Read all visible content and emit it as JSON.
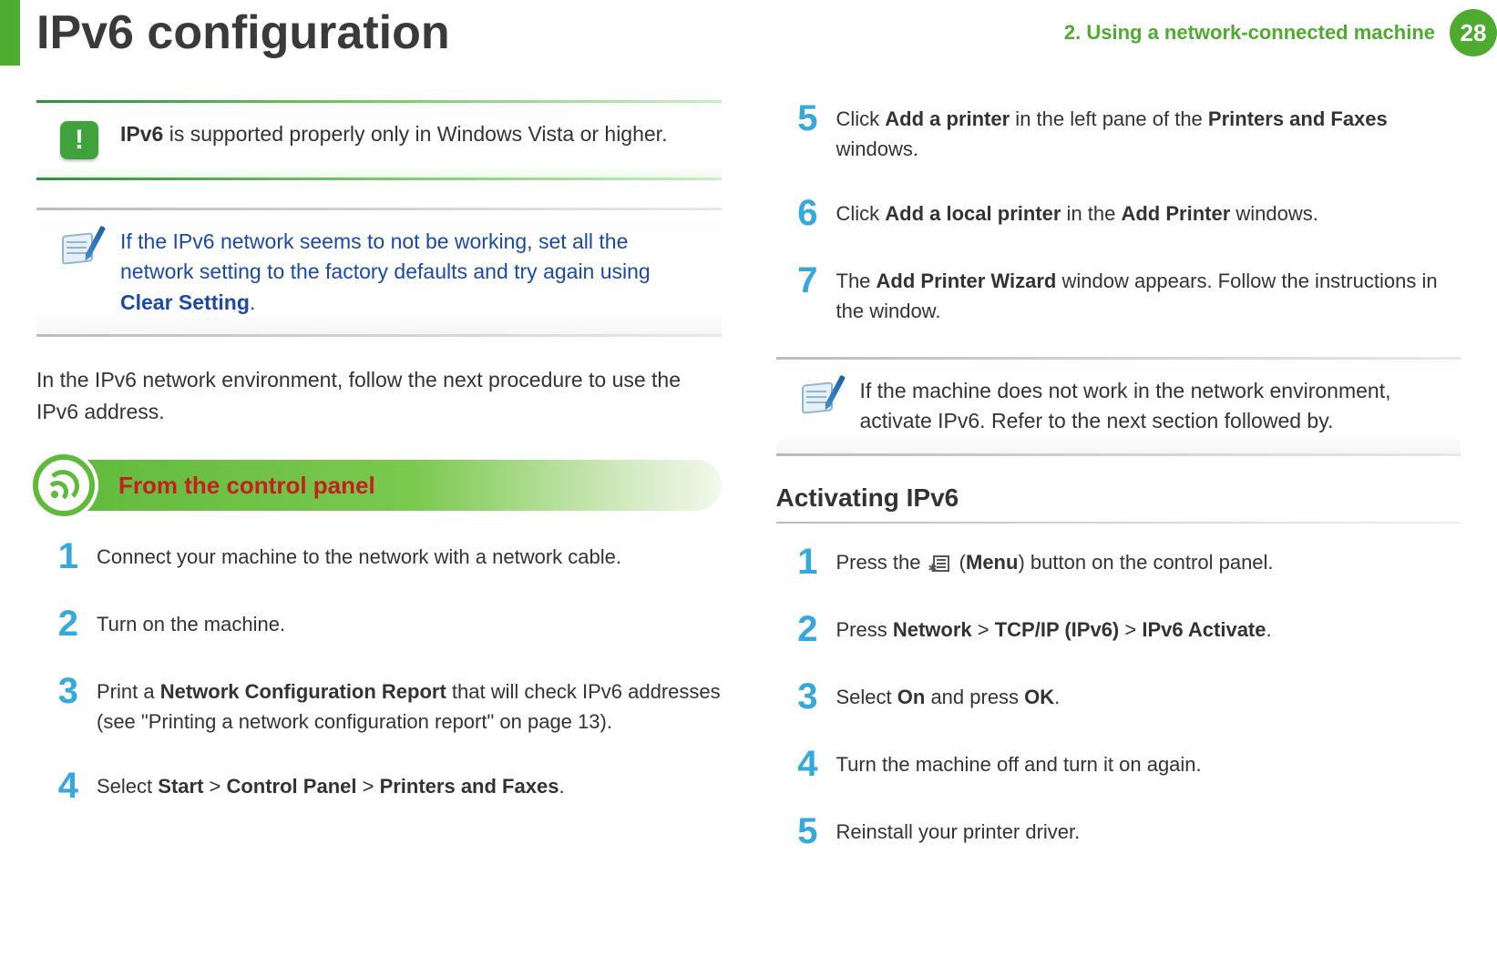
{
  "header": {
    "title": "IPv6 configuration",
    "chapter": "2.  Using a network-connected machine",
    "page_number": "28"
  },
  "left": {
    "alert": {
      "prefix_bold": "IPv6",
      "rest": " is supported properly only in Windows Vista or higher."
    },
    "tip": {
      "line1": "If the IPv6 network seems to not be working, set all the network setting to the factory defaults and try again using ",
      "bold": "Clear Setting",
      "after": "."
    },
    "intro": "In the IPv6 network environment, follow the next procedure to use the IPv6 address.",
    "section_title": "From the control panel",
    "steps": {
      "s1": "Connect your machine to the network with a network cable.",
      "s2": "Turn on the machine.",
      "s3_a": "Print a ",
      "s3_b": "Network Configuration Report",
      "s3_c": " that will check IPv6 addresses (see \"Printing a network configuration report\" on page 13).",
      "s4_a": "Select ",
      "s4_b": "Start",
      "s4_c": " > ",
      "s4_d": "Control Panel",
      "s4_e": " > ",
      "s4_f": "Printers and Faxes",
      "s4_g": "."
    }
  },
  "right": {
    "steps": {
      "s5_a": "Click ",
      "s5_b": "Add a printer",
      "s5_c": " in the left pane of the ",
      "s5_d": "Printers and Faxes",
      "s5_e": " windows.",
      "s6_a": "Click ",
      "s6_b": "Add a local printer",
      "s6_c": " in the ",
      "s6_d": "Add Printer",
      "s6_e": " windows.",
      "s7_a": "The ",
      "s7_b": "Add Printer Wizard",
      "s7_c": " window appears. Follow the instructions in the window."
    },
    "tip": "If the machine does not work in the network environment, activate IPv6. Refer to the next section followed by.",
    "subheading": "Activating IPv6",
    "act_steps": {
      "s1_a": "Press the ",
      "s1_b": " (",
      "s1_c": "Menu",
      "s1_d": ") button on the control panel.",
      "s2_a": "Press ",
      "s2_b": "Network",
      "s2_c": " > ",
      "s2_d": "TCP/IP (IPv6)",
      "s2_e": " > ",
      "s2_f": "IPv6 Activate",
      "s2_g": ".",
      "s3_a": "Select ",
      "s3_b": "On",
      "s3_c": " and press ",
      "s3_d": "OK",
      "s3_e": ".",
      "s4": "Turn the machine off and turn it on again.",
      "s5": "Reinstall your printer driver."
    }
  },
  "nums": {
    "n1": "1",
    "n2": "2",
    "n3": "3",
    "n4": "4",
    "n5": "5",
    "n6": "6",
    "n7": "7"
  }
}
